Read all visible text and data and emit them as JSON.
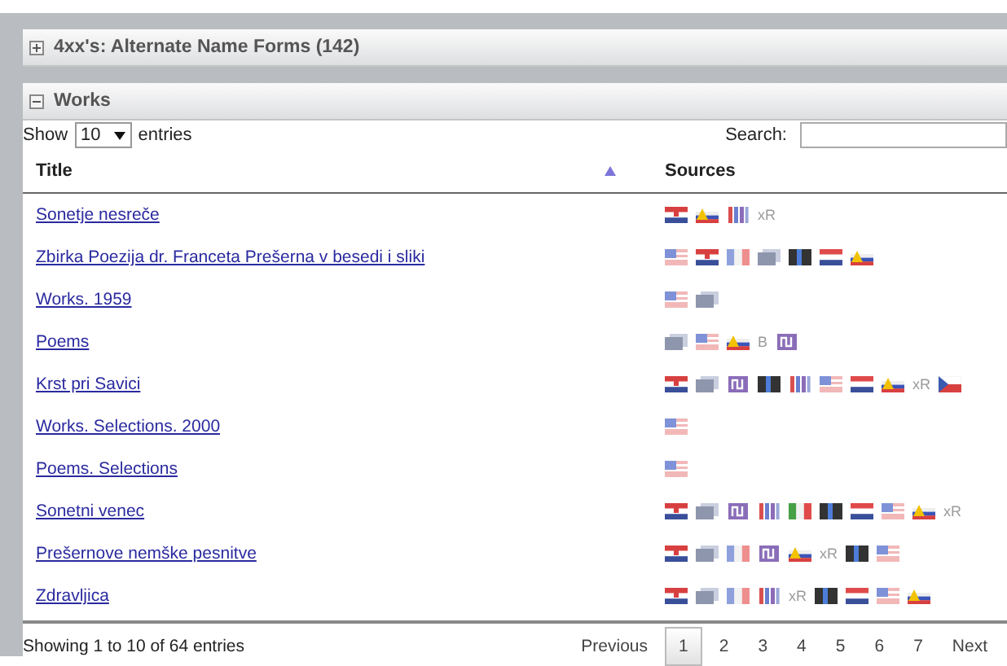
{
  "panels": [
    {
      "title": "4xx's: Alternate Name Forms (142)",
      "expanded": false
    },
    {
      "title": "Works",
      "expanded": true
    }
  ],
  "length_menu": {
    "label_before": "Show",
    "value": "10",
    "label_after": "entries"
  },
  "search": {
    "label": "Search:"
  },
  "table": {
    "columns": [
      {
        "label": "Title",
        "sorted": true
      },
      {
        "label": "Sources",
        "sorted": false
      }
    ],
    "rows": [
      {
        "title": "Sonetje nesreče",
        "sources": [
          {
            "kind": "hr"
          },
          {
            "kind": "warn"
          },
          {
            "kind": "bars"
          },
          {
            "kind": "text",
            "text": "xR"
          }
        ]
      },
      {
        "title": "Zbirka Poezija dr. Franceta Prešerna v besedi i sliki",
        "sources": [
          {
            "kind": "us"
          },
          {
            "kind": "hr"
          },
          {
            "kind": "fr"
          },
          {
            "kind": "book"
          },
          {
            "kind": "dnb"
          },
          {
            "kind": "nl"
          },
          {
            "kind": "warn"
          }
        ]
      },
      {
        "title": "Works. 1959",
        "sources": [
          {
            "kind": "us"
          },
          {
            "kind": "book"
          }
        ]
      },
      {
        "title": "Poems",
        "sources": [
          {
            "kind": "book"
          },
          {
            "kind": "us"
          },
          {
            "kind": "warn"
          },
          {
            "kind": "text",
            "text": "B"
          },
          {
            "kind": "nu"
          }
        ]
      },
      {
        "title": "Krst pri Savici",
        "sources": [
          {
            "kind": "hr"
          },
          {
            "kind": "book"
          },
          {
            "kind": "nu"
          },
          {
            "kind": "dnb"
          },
          {
            "kind": "bars"
          },
          {
            "kind": "us"
          },
          {
            "kind": "nl"
          },
          {
            "kind": "warn"
          },
          {
            "kind": "text",
            "text": "xR"
          },
          {
            "kind": "cz"
          }
        ]
      },
      {
        "title": "Works. Selections. 2000",
        "sources": [
          {
            "kind": "us"
          }
        ]
      },
      {
        "title": "Poems. Selections",
        "sources": [
          {
            "kind": "us"
          }
        ]
      },
      {
        "title": "Sonetni venec",
        "sources": [
          {
            "kind": "hr"
          },
          {
            "kind": "book"
          },
          {
            "kind": "nu"
          },
          {
            "kind": "bars"
          },
          {
            "kind": "it"
          },
          {
            "kind": "dnb"
          },
          {
            "kind": "nl"
          },
          {
            "kind": "us"
          },
          {
            "kind": "warn"
          },
          {
            "kind": "text",
            "text": "xR"
          }
        ]
      },
      {
        "title": "Prešernove nemške pesnitve",
        "sources": [
          {
            "kind": "hr"
          },
          {
            "kind": "book"
          },
          {
            "kind": "fr"
          },
          {
            "kind": "nu"
          },
          {
            "kind": "warn"
          },
          {
            "kind": "text",
            "text": "xR"
          },
          {
            "kind": "dnb"
          },
          {
            "kind": "us"
          }
        ]
      },
      {
        "title": "Zdravljica",
        "sources": [
          {
            "kind": "hr"
          },
          {
            "kind": "book"
          },
          {
            "kind": "fr"
          },
          {
            "kind": "bars"
          },
          {
            "kind": "text",
            "text": "xR"
          },
          {
            "kind": "dnb"
          },
          {
            "kind": "nl"
          },
          {
            "kind": "us"
          },
          {
            "kind": "warn"
          }
        ]
      }
    ]
  },
  "info": "Showing 1 to 10 of 64 entries",
  "pagination": {
    "previous": "Previous",
    "next": "Next",
    "pages": [
      {
        "label": "1",
        "selected": true
      },
      {
        "label": "2",
        "selected": false
      },
      {
        "label": "3",
        "selected": false
      },
      {
        "label": "4",
        "selected": false
      },
      {
        "label": "5",
        "selected": false
      },
      {
        "label": "6",
        "selected": false
      },
      {
        "label": "7",
        "selected": false
      }
    ]
  }
}
